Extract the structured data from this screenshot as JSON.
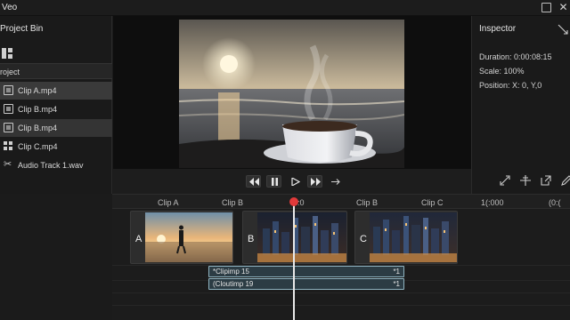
{
  "app": {
    "title": "Veo"
  },
  "project_bin": {
    "title": "Project Bin",
    "section": "roject",
    "items": [
      {
        "label": "Clip A.mp4",
        "icon": "clip-icon"
      },
      {
        "label": "Clip B.mp4",
        "icon": "clip-icon"
      },
      {
        "label": "Clip B.mp4",
        "icon": "clip-icon"
      },
      {
        "label": "Clip C.mp4",
        "icon": "grid-icon"
      },
      {
        "label": "Audio Track 1.wav",
        "icon": "audio-icon"
      }
    ]
  },
  "inspector": {
    "title": "Inspector",
    "duration": "Duration: 0:00:08:15",
    "scale": "Scale: 100%",
    "position": "Position: X: 0, Y,0"
  },
  "timeline": {
    "ruler_labels": [
      "Clip A",
      "Clip B",
      ":0",
      "Clip B",
      "Clip C",
      "1(:000",
      "(0:("
    ],
    "clips": [
      {
        "letter": "A"
      },
      {
        "letter": "B"
      },
      {
        "letter": "C"
      }
    ],
    "audio": [
      {
        "label": "*Clipimp 15",
        "right": "*1"
      },
      {
        "label": "(Cloutimp 19",
        "right": "*1"
      }
    ]
  },
  "colors": {
    "background": "#1b1b1b",
    "playhead": "#e23a3a",
    "audio_clip_border": "#8fb3c0"
  }
}
